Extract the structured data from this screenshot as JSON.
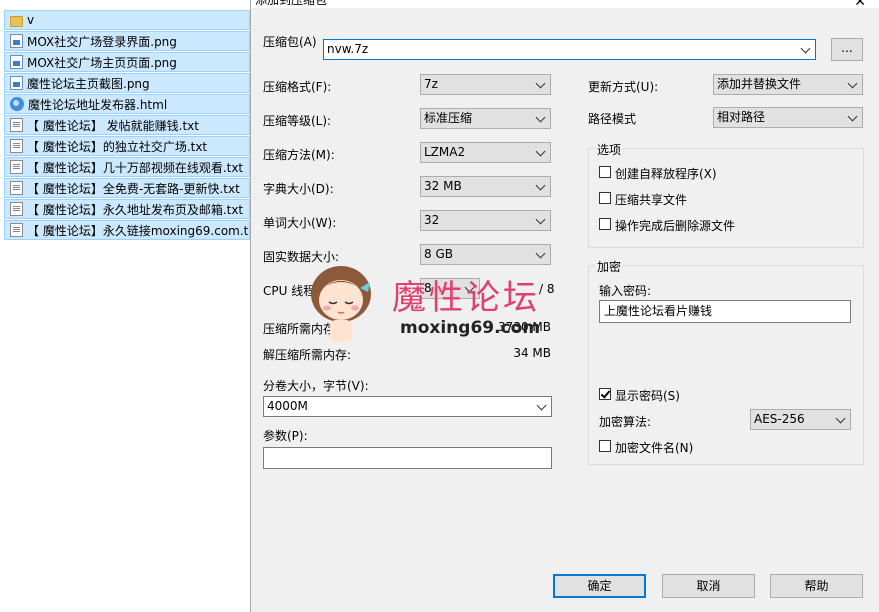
{
  "files": [
    {
      "name": "v",
      "icon": "folder-icon",
      "type": "folder"
    },
    {
      "name": "MOX社交广场登录界面.png",
      "icon": "image-file-icon",
      "type": "image"
    },
    {
      "name": "MOX社交广场主页页面.png",
      "icon": "image-file-icon",
      "type": "image"
    },
    {
      "name": "魔性论坛主页截图.png",
      "icon": "image-file-icon",
      "type": "image"
    },
    {
      "name": "魔性论坛地址发布器.html",
      "icon": "html-file-icon",
      "type": "html"
    },
    {
      "name": "【 魔性论坛】 发帖就能赚钱.txt",
      "icon": "text-file-icon",
      "type": "text"
    },
    {
      "name": "【 魔性论坛】的独立社交广场.txt",
      "icon": "text-file-icon",
      "type": "text"
    },
    {
      "name": "【 魔性论坛】几十万部视频在线观看.txt",
      "icon": "text-file-icon",
      "type": "text"
    },
    {
      "name": "【 魔性论坛】全免费-无套路-更新快.txt",
      "icon": "text-file-icon",
      "type": "text"
    },
    {
      "name": "【 魔性论坛】永久地址发布页及邮箱.txt",
      "icon": "text-file-icon",
      "type": "text"
    },
    {
      "name": "【 魔性论坛】永久链接moxing69.com.txt",
      "icon": "text-file-icon",
      "type": "text"
    }
  ],
  "dialog": {
    "title": "添加到压缩包",
    "archive_label": "压缩包(A)",
    "archive_value": "nvw.7z",
    "browse_label": "...",
    "left": {
      "format_label": "压缩格式(F):",
      "format_value": "7z",
      "level_label": "压缩等级(L):",
      "level_value": "标准压缩",
      "method_label": "压缩方法(M):",
      "method_value": "LZMA2",
      "dict_label": "字典大小(D):",
      "dict_value": "32 MB",
      "word_label": "单词大小(W):",
      "word_value": "32",
      "solid_label": "固实数据大小:",
      "solid_value": "8 GB",
      "cpu_label": "CPU 线程数:",
      "cpu_value": "8",
      "cpu_total": "/ 8",
      "mem_comp_label": "压缩所需内存:",
      "mem_comp_value": "3730 MB",
      "mem_decomp_label": "解压缩所需内存:",
      "mem_decomp_value": "34 MB",
      "split_label": "分卷大小，字节(V):",
      "split_value": "4000M",
      "params_label": "参数(P):",
      "params_value": ""
    },
    "right": {
      "update_label": "更新方式(U):",
      "update_value": "添加并替换文件",
      "path_label": "路径模式",
      "path_value": "相对路径",
      "options_title": "选项",
      "opt_sfx": "创建自释放程序(X)",
      "opt_shared": "压缩共享文件",
      "opt_delete": "操作完成后删除源文件",
      "encrypt_title": "加密",
      "password_label": "输入密码:",
      "password_value": "上魔性论坛看片赚钱",
      "show_password": "显示密码(S)",
      "method_label": "加密算法:",
      "method_value": "AES-256",
      "encrypt_names": "加密文件名(N)"
    },
    "buttons": {
      "ok": "确定",
      "cancel": "取消",
      "help": "帮助"
    }
  },
  "watermark": {
    "title": "魔性论坛",
    "url": "moxing69.com"
  },
  "colors": {
    "selection": "#cce8ff",
    "dialog_bg": "#f0f0f0",
    "accent": "#0078d7",
    "watermark": "#e0406e"
  }
}
